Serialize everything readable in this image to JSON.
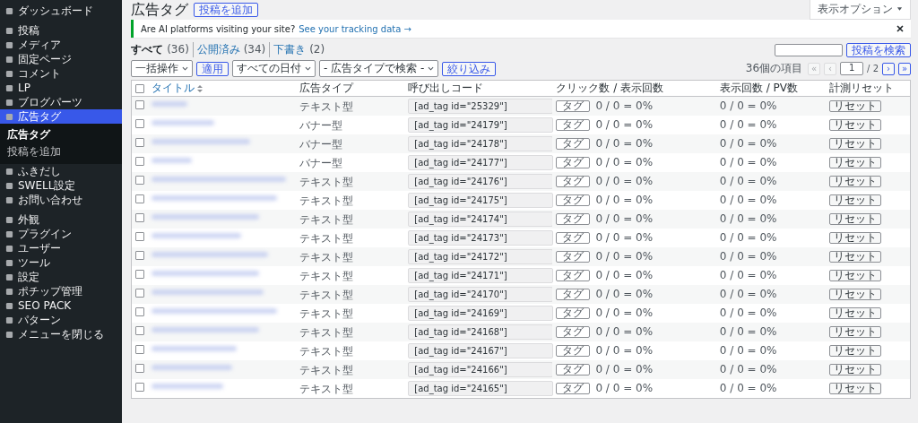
{
  "sidebar": {
    "items": [
      {
        "label": "ダッシュボード",
        "current": false
      },
      {
        "kind": "separator"
      },
      {
        "label": "投稿",
        "current": false
      },
      {
        "label": "メディア",
        "current": false
      },
      {
        "label": "固定ページ",
        "current": false
      },
      {
        "label": "コメント",
        "current": false
      },
      {
        "label": "LP",
        "current": false
      },
      {
        "label": "ブログパーツ",
        "current": false
      },
      {
        "label": "広告タグ",
        "current": true
      },
      {
        "label": "ふきだし",
        "current": false
      },
      {
        "label": "SWELL設定",
        "current": false
      },
      {
        "label": "お問い合わせ",
        "current": false
      },
      {
        "kind": "separator"
      },
      {
        "label": "外観",
        "current": false
      },
      {
        "label": "プラグイン",
        "current": false
      },
      {
        "label": "ユーザー",
        "current": false
      },
      {
        "label": "ツール",
        "current": false
      },
      {
        "label": "設定",
        "current": false
      },
      {
        "label": "ポチップ管理",
        "current": false
      },
      {
        "label": "SEO PACK",
        "current": false
      },
      {
        "label": "パターン",
        "current": false
      },
      {
        "label": "メニューを閉じる",
        "current": false
      }
    ],
    "submenu": [
      {
        "label": "広告タグ",
        "selected": true
      },
      {
        "label": "投稿を追加",
        "selected": false
      }
    ]
  },
  "header": {
    "title": "広告タグ",
    "add_button": "投稿を追加",
    "screen_options": "表示オプション"
  },
  "notice": {
    "text": "Are AI platforms visiting your site?",
    "link": "See your tracking data →"
  },
  "views": [
    {
      "label": "すべて",
      "count": "(36)",
      "selected": true
    },
    {
      "label": "公開済み",
      "count": "(34)",
      "selected": false
    },
    {
      "label": "下書き",
      "count": "(2)",
      "selected": false
    }
  ],
  "search": {
    "button": "投稿を検索"
  },
  "bulk_actions": {
    "select": "一括操作",
    "apply": "適用"
  },
  "filters": {
    "date": "すべての日付",
    "ad_type": "- 広告タイプで検索 -",
    "button": "絞り込み"
  },
  "pagination": {
    "count": "36個の項目",
    "first": {
      "label": "«",
      "disabled": true
    },
    "prev": {
      "label": "‹",
      "disabled": true
    },
    "page": "1",
    "total": "/ 2",
    "next": {
      "label": "›",
      "disabled": false
    },
    "last": {
      "label": "»",
      "disabled": false
    }
  },
  "table": {
    "select_all_checked": false,
    "columns": [
      "タイトル",
      "広告タイプ",
      "呼び出しコード",
      "クリック数 / 表示回数",
      "表示回数 / PV数",
      "計測リセット"
    ],
    "rows": [
      {
        "checked": false,
        "type": "テキスト型",
        "code": "[ad_tag id=\"25329\"]",
        "tag_button": "タグ",
        "clicks": "0 / 0 = 0%",
        "views": "0 / 0 = 0%",
        "reset": "リセット"
      },
      {
        "checked": false,
        "type": "バナー型",
        "code": "[ad_tag id=\"24179\"]",
        "tag_button": "タグ",
        "clicks": "0 / 0 = 0%",
        "views": "0 / 0 = 0%",
        "reset": "リセット"
      },
      {
        "checked": false,
        "type": "バナー型",
        "code": "[ad_tag id=\"24178\"]",
        "tag_button": "タグ",
        "clicks": "0 / 0 = 0%",
        "views": "0 / 0 = 0%",
        "reset": "リセット"
      },
      {
        "checked": false,
        "type": "バナー型",
        "code": "[ad_tag id=\"24177\"]",
        "tag_button": "タグ",
        "clicks": "0 / 0 = 0%",
        "views": "0 / 0 = 0%",
        "reset": "リセット"
      },
      {
        "checked": false,
        "type": "テキスト型",
        "code": "[ad_tag id=\"24176\"]",
        "tag_button": "タグ",
        "clicks": "0 / 0 = 0%",
        "views": "0 / 0 = 0%",
        "reset": "リセット"
      },
      {
        "checked": false,
        "type": "テキスト型",
        "code": "[ad_tag id=\"24175\"]",
        "tag_button": "タグ",
        "clicks": "0 / 0 = 0%",
        "views": "0 / 0 = 0%",
        "reset": "リセット"
      },
      {
        "checked": false,
        "type": "テキスト型",
        "code": "[ad_tag id=\"24174\"]",
        "tag_button": "タグ",
        "clicks": "0 / 0 = 0%",
        "views": "0 / 0 = 0%",
        "reset": "リセット"
      },
      {
        "checked": false,
        "type": "テキスト型",
        "code": "[ad_tag id=\"24173\"]",
        "tag_button": "タグ",
        "clicks": "0 / 0 = 0%",
        "views": "0 / 0 = 0%",
        "reset": "リセット"
      },
      {
        "checked": false,
        "type": "テキスト型",
        "code": "[ad_tag id=\"24172\"]",
        "tag_button": "タグ",
        "clicks": "0 / 0 = 0%",
        "views": "0 / 0 = 0%",
        "reset": "リセット"
      },
      {
        "checked": false,
        "type": "テキスト型",
        "code": "[ad_tag id=\"24171\"]",
        "tag_button": "タグ",
        "clicks": "0 / 0 = 0%",
        "views": "0 / 0 = 0%",
        "reset": "リセット"
      },
      {
        "checked": false,
        "type": "テキスト型",
        "code": "[ad_tag id=\"24170\"]",
        "tag_button": "タグ",
        "clicks": "0 / 0 = 0%",
        "views": "0 / 0 = 0%",
        "reset": "リセット"
      },
      {
        "checked": false,
        "type": "テキスト型",
        "code": "[ad_tag id=\"24169\"]",
        "tag_button": "タグ",
        "clicks": "0 / 0 = 0%",
        "views": "0 / 0 = 0%",
        "reset": "リセット"
      },
      {
        "checked": false,
        "type": "テキスト型",
        "code": "[ad_tag id=\"24168\"]",
        "tag_button": "タグ",
        "clicks": "0 / 0 = 0%",
        "views": "0 / 0 = 0%",
        "reset": "リセット"
      },
      {
        "checked": false,
        "type": "テキスト型",
        "code": "[ad_tag id=\"24167\"]",
        "tag_button": "タグ",
        "clicks": "0 / 0 = 0%",
        "views": "0 / 0 = 0%",
        "reset": "リセット"
      },
      {
        "checked": false,
        "type": "テキスト型",
        "code": "[ad_tag id=\"24166\"]",
        "tag_button": "タグ",
        "clicks": "0 / 0 = 0%",
        "views": "0 / 0 = 0%",
        "reset": "リセット"
      },
      {
        "checked": false,
        "type": "テキスト型",
        "code": "[ad_tag id=\"24165\"]",
        "tag_button": "タグ",
        "clicks": "0 / 0 = 0%",
        "views": "0 / 0 = 0%",
        "reset": "リセット"
      }
    ]
  }
}
